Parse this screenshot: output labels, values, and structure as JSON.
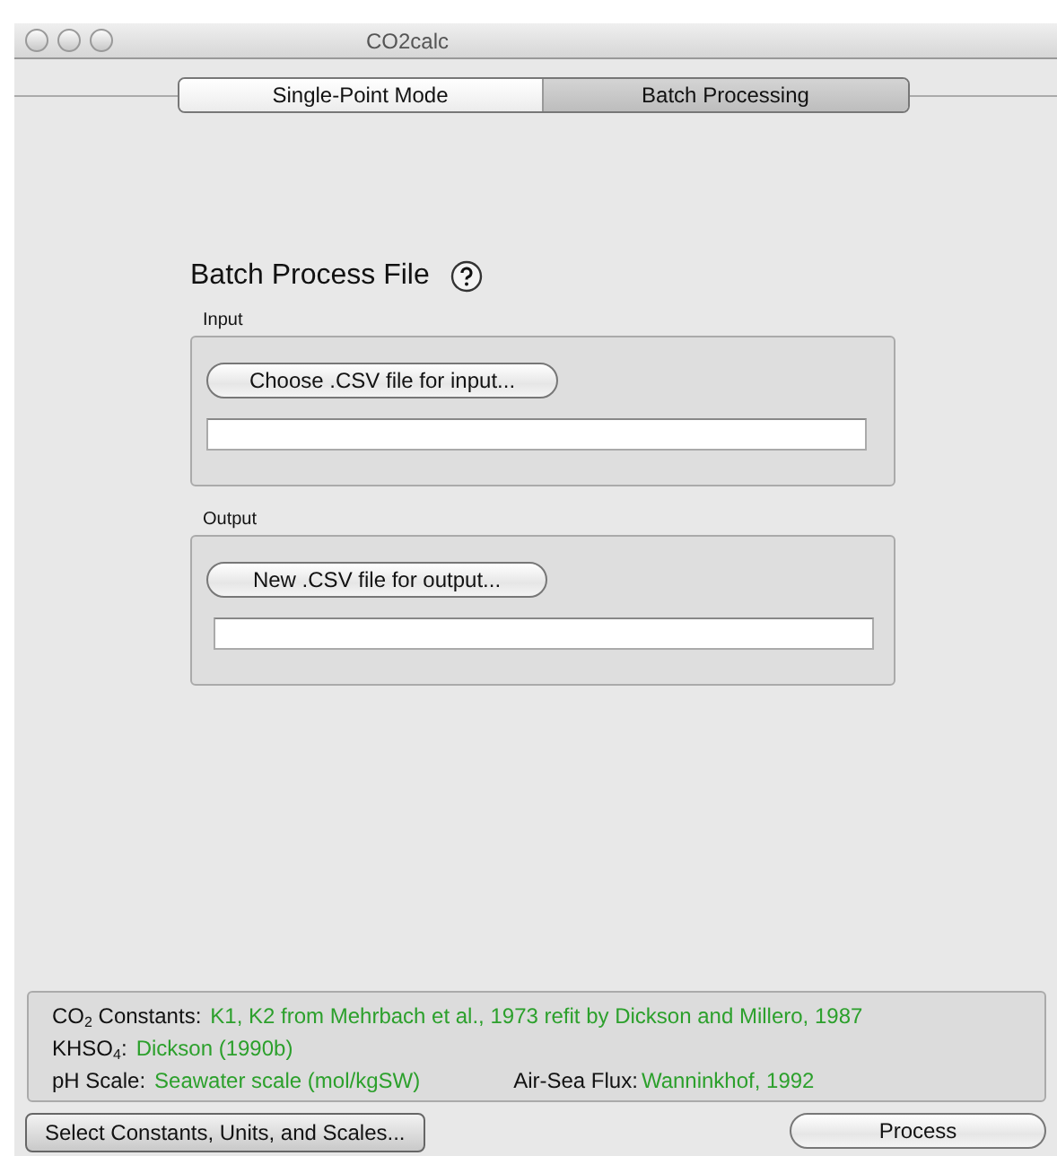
{
  "window": {
    "title": "CO2calc"
  },
  "tabs": [
    {
      "label": "Single-Point Mode",
      "selected": false
    },
    {
      "label": "Batch Processing",
      "selected": true
    }
  ],
  "heading": "Batch Process File",
  "groups": [
    {
      "title": "Input",
      "button": "Choose .CSV file for input..."
    },
    {
      "title": "Output",
      "button": "New .CSV file for output..."
    }
  ],
  "settings": [
    [
      {
        "label": "CO$_{2}$ Constants:",
        "value": "K1, K2 from Mehrbach et al., 1973 refit by Dickson and Millero, 1987"
      }
    ],
    [
      {
        "label": "KHSO$_{4}$:",
        "value": "Dickson (1990b)"
      }
    ],
    [
      {
        "label": "pH Scale:",
        "value": "Seawater scale (mol/kgSW)"
      },
      {
        "label": "Air-Sea Flux:",
        "value": "Wanninkhof, 1992"
      }
    ]
  ],
  "buttons": {
    "select": "Select Constants, Units, and Scales...",
    "process": "Process"
  }
}
